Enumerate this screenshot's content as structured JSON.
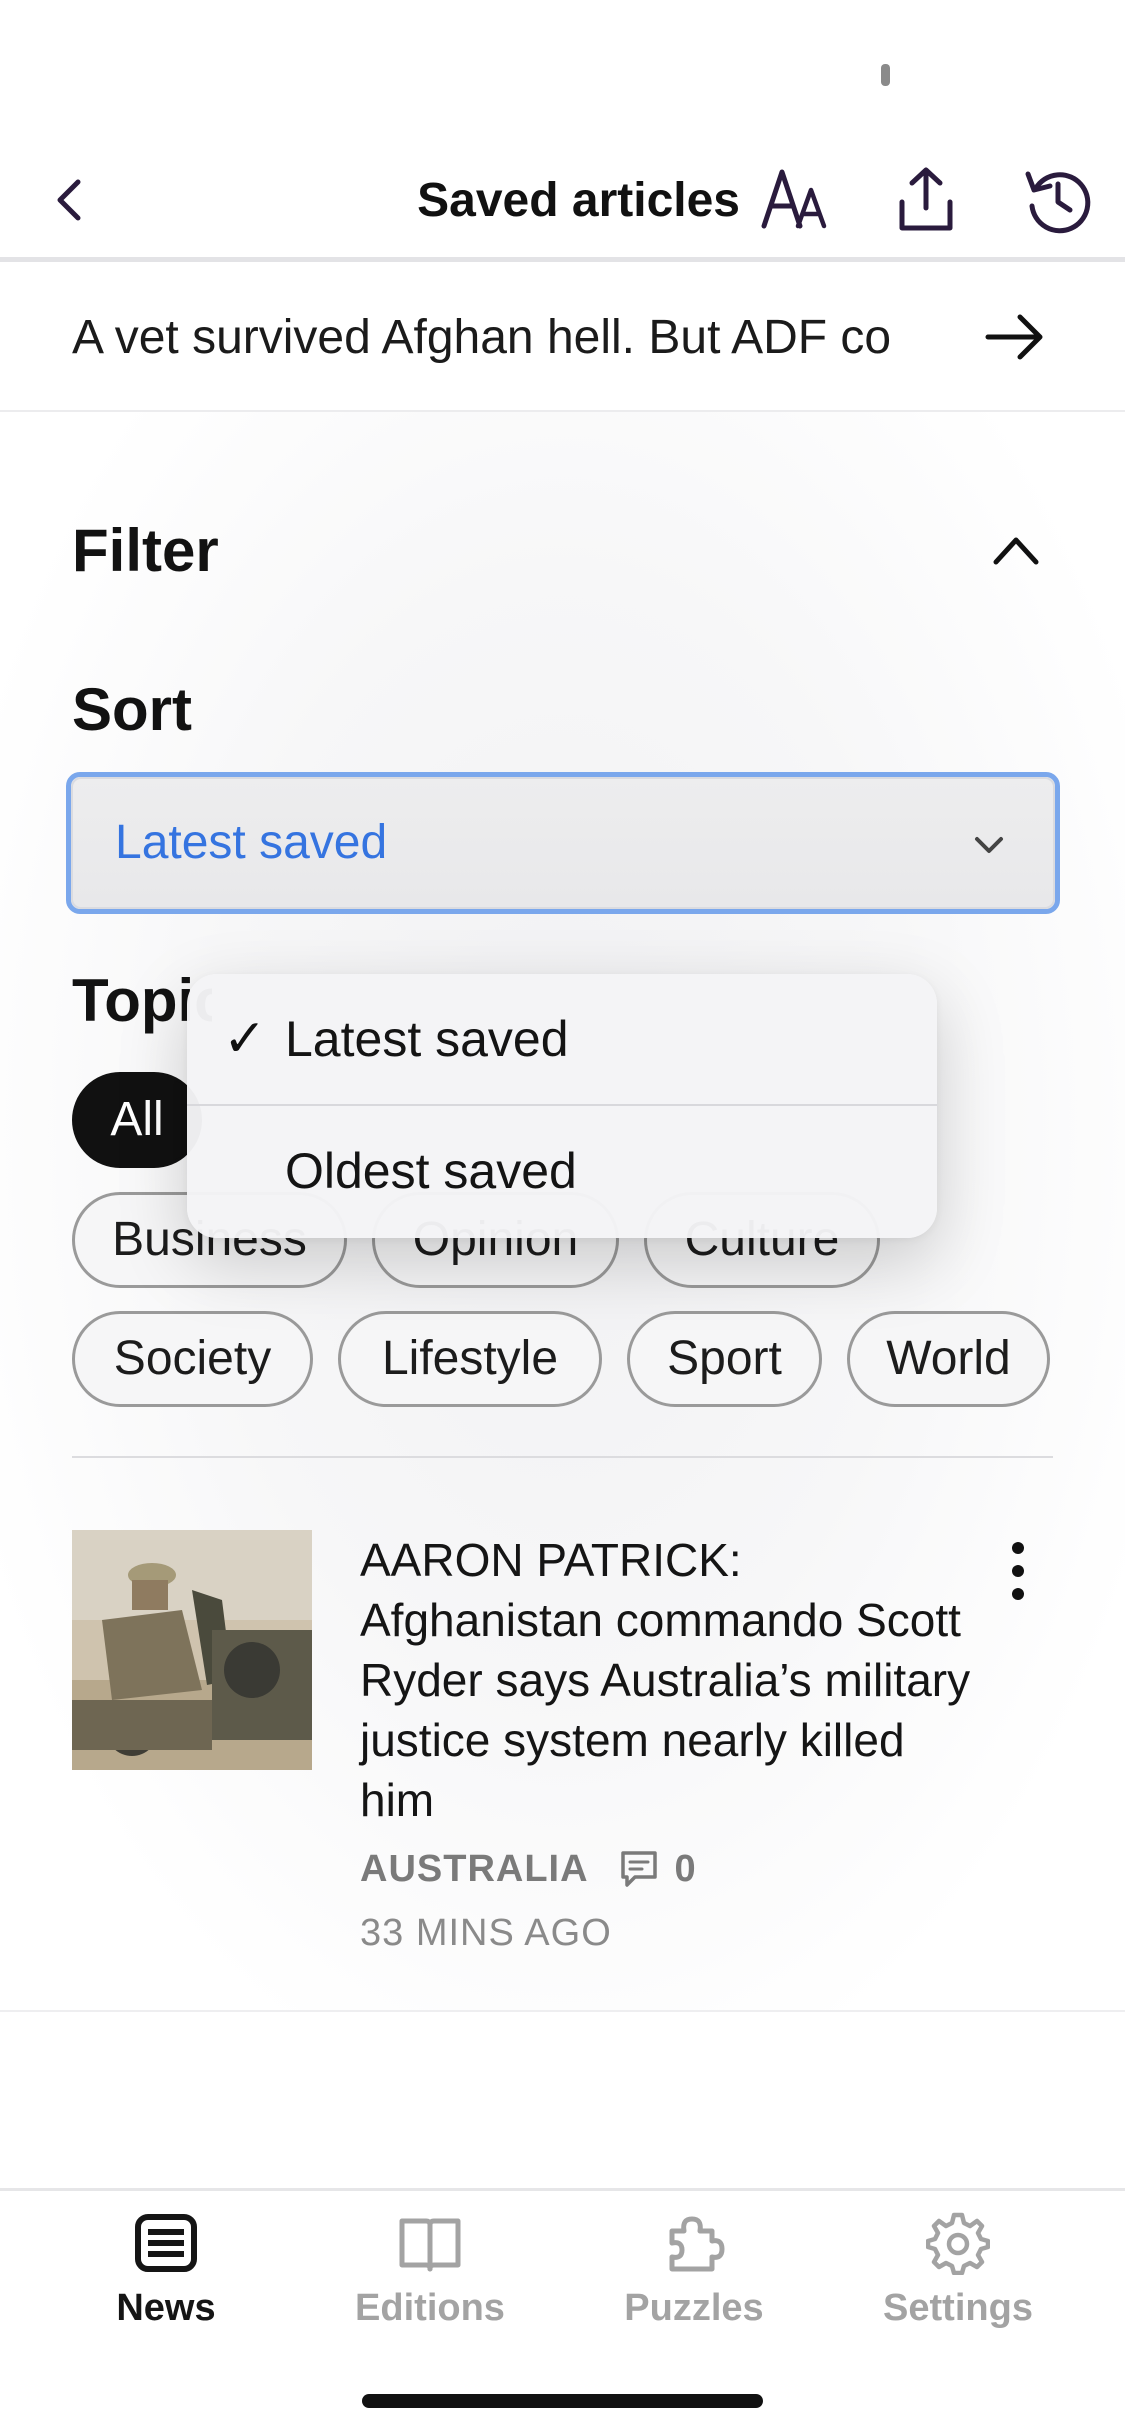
{
  "header": {
    "title": "Saved articles",
    "back_icon": "chevron-left-icon",
    "actions": [
      {
        "name": "text-size",
        "icon": "text-size-icon"
      },
      {
        "name": "share",
        "icon": "share-icon"
      },
      {
        "name": "refresh",
        "icon": "refresh-icon"
      }
    ]
  },
  "headline": {
    "text": "A vet survived Afghan hell. But ADF co",
    "icon": "arrow-right-icon"
  },
  "filter": {
    "title": "Filter",
    "expanded": true,
    "sort_label": "Sort",
    "sort_value": "Latest saved",
    "topic_label": "Topics",
    "sort_options": [
      {
        "label": "Latest saved",
        "selected": true,
        "check": "✓"
      },
      {
        "label": "Oldest saved",
        "selected": false
      }
    ],
    "topics": [
      {
        "label": "All",
        "active": true
      },
      {
        "label": "Business",
        "active": false
      },
      {
        "label": "Opinion",
        "active": false
      },
      {
        "label": "Culture",
        "active": false
      },
      {
        "label": "Society",
        "active": false
      },
      {
        "label": "Lifestyle",
        "active": false
      },
      {
        "label": "Sport",
        "active": false
      },
      {
        "label": "World",
        "active": false
      }
    ]
  },
  "articles": [
    {
      "title": "AARON PATRICK: Afghanistan commando Scott Ryder says Australia’s military justice system nearly killed him",
      "section": "AUSTRALIA",
      "comments": "0",
      "time": "33 MINS AGO"
    }
  ],
  "tabs": [
    {
      "label": "News",
      "icon": "news-icon",
      "active": true
    },
    {
      "label": "Editions",
      "icon": "book-icon",
      "active": false
    },
    {
      "label": "Puzzles",
      "icon": "puzzle-icon",
      "active": false
    },
    {
      "label": "Settings",
      "icon": "gear-icon",
      "active": false
    }
  ],
  "colors": {
    "accent_blue": "#3574e0",
    "select_border": "#7aa7ec",
    "nav_icon": "#2a1b3d",
    "muted": "#a3a3a3"
  }
}
